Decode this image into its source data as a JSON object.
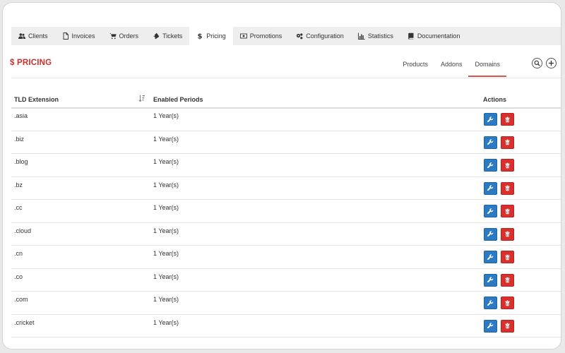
{
  "nav": {
    "items": [
      {
        "label": "Clients",
        "icon": "users-icon"
      },
      {
        "label": "Invoices",
        "icon": "file-icon"
      },
      {
        "label": "Orders",
        "icon": "cart-icon"
      },
      {
        "label": "Tickets",
        "icon": "ticket-icon"
      },
      {
        "label": "Pricing",
        "icon": "dollar-icon"
      },
      {
        "label": "Promotions",
        "icon": "money-icon"
      },
      {
        "label": "Configuration",
        "icon": "gears-icon"
      },
      {
        "label": "Statistics",
        "icon": "bar-chart-icon"
      },
      {
        "label": "Documentation",
        "icon": "book-icon"
      }
    ],
    "active_index": 4
  },
  "page": {
    "title": "$ PRICING"
  },
  "subtabs": {
    "products": "Products",
    "addons": "Addons",
    "domains": "Domains",
    "active": "Domains"
  },
  "table": {
    "headers": {
      "tld": "TLD Extension",
      "periods": "Enabled Periods",
      "actions": "Actions"
    },
    "rows": [
      {
        "tld": ".asia",
        "periods": "1 Year(s)"
      },
      {
        "tld": ".biz",
        "periods": "1 Year(s)"
      },
      {
        "tld": ".blog",
        "periods": "1 Year(s)"
      },
      {
        "tld": ".bz",
        "periods": "1 Year(s)"
      },
      {
        "tld": ".cc",
        "periods": "1 Year(s)"
      },
      {
        "tld": ".cloud",
        "periods": "1 Year(s)"
      },
      {
        "tld": ".cn",
        "periods": "1 Year(s)"
      },
      {
        "tld": ".co",
        "periods": "1 Year(s)"
      },
      {
        "tld": ".com",
        "periods": "1 Year(s)"
      },
      {
        "tld": ".cricket",
        "periods": "1 Year(s)"
      }
    ]
  },
  "colors": {
    "accent_red": "#c9302c",
    "edit_blue": "#2a7ac5",
    "delete_red": "#d9302e"
  }
}
